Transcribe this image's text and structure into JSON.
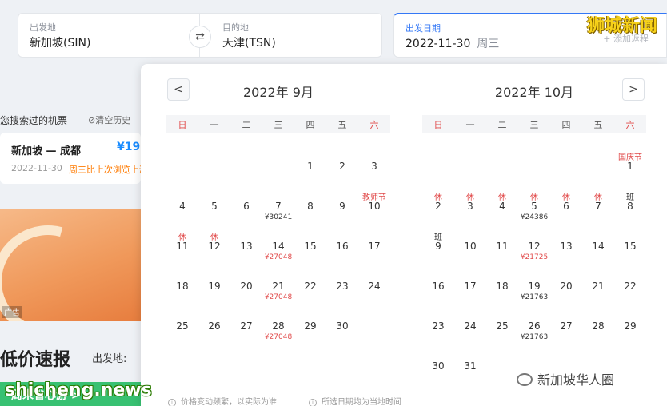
{
  "search": {
    "from_label": "出发地",
    "from_value": "新加坡(SIN)",
    "to_label": "目的地",
    "to_value": "天津(TSN)",
    "date_label": "出发日期",
    "date_value": "2022-11-30",
    "date_weekday": "周三",
    "add_return": "+ 添加返程",
    "swap_icon": "swap-icon"
  },
  "watermarks": {
    "top": "狮城新闻",
    "bottom": "shicheng.news"
  },
  "history": {
    "title": "您搜索过的机票",
    "clear": "⊘清空历史",
    "item": {
      "route": "新加坡 — 成都",
      "price": "¥19",
      "date": "2022-11-30",
      "note": "周三比上次浏览上涨"
    }
  },
  "ad_tag": "广告",
  "lowprice": {
    "title": "低价速报",
    "from_label": "出发地:"
  },
  "green_banner": "周末省心游 >",
  "calendar": {
    "prev_icon": "chevron-left-icon",
    "next_icon": "chevron-right-icon",
    "weekdays": [
      "日",
      "一",
      "二",
      "三",
      "四",
      "五",
      "六"
    ],
    "months": [
      {
        "title": "2022年 9月",
        "first_weekday": 4,
        "days": [
          {
            "d": "1"
          },
          {
            "d": "2"
          },
          {
            "d": "3"
          },
          {
            "d": "4"
          },
          {
            "d": "5"
          },
          {
            "d": "6"
          },
          {
            "d": "7",
            "price": "¥30241"
          },
          {
            "d": "8"
          },
          {
            "d": "9"
          },
          {
            "d": "10",
            "tag": "教师节"
          },
          {
            "d": "11",
            "tag": "休"
          },
          {
            "d": "12",
            "tag": "休"
          },
          {
            "d": "13"
          },
          {
            "d": "14",
            "price": "¥27048",
            "red": true
          },
          {
            "d": "15"
          },
          {
            "d": "16"
          },
          {
            "d": "17"
          },
          {
            "d": "18"
          },
          {
            "d": "19"
          },
          {
            "d": "20"
          },
          {
            "d": "21",
            "price": "¥27048",
            "red": true
          },
          {
            "d": "22"
          },
          {
            "d": "23"
          },
          {
            "d": "24"
          },
          {
            "d": "25"
          },
          {
            "d": "26"
          },
          {
            "d": "27"
          },
          {
            "d": "28",
            "price": "¥27048",
            "red": true
          },
          {
            "d": "29"
          },
          {
            "d": "30"
          }
        ]
      },
      {
        "title": "2022年 10月",
        "first_weekday": 6,
        "days": [
          {
            "d": "1",
            "tag": "国庆节"
          },
          {
            "d": "2",
            "tag": "休"
          },
          {
            "d": "3",
            "tag": "休"
          },
          {
            "d": "4",
            "tag": "休"
          },
          {
            "d": "5",
            "tag": "休",
            "price": "¥24386"
          },
          {
            "d": "6",
            "tag": "休"
          },
          {
            "d": "7",
            "tag": "休"
          },
          {
            "d": "8",
            "tag": "班",
            "work": true
          },
          {
            "d": "9",
            "tag": "班",
            "work": true
          },
          {
            "d": "10"
          },
          {
            "d": "11"
          },
          {
            "d": "12",
            "price": "¥21725",
            "red": true
          },
          {
            "d": "13"
          },
          {
            "d": "14"
          },
          {
            "d": "15"
          },
          {
            "d": "16"
          },
          {
            "d": "17"
          },
          {
            "d": "18"
          },
          {
            "d": "19",
            "price": "¥21763"
          },
          {
            "d": "20"
          },
          {
            "d": "21"
          },
          {
            "d": "22"
          },
          {
            "d": "23"
          },
          {
            "d": "24"
          },
          {
            "d": "25"
          },
          {
            "d": "26",
            "price": "¥21763"
          },
          {
            "d": "27"
          },
          {
            "d": "28"
          },
          {
            "d": "29"
          },
          {
            "d": "30"
          },
          {
            "d": "31"
          }
        ]
      }
    ],
    "footnotes": [
      "价格变动频繁，以实际为准",
      "所选日期均为当地时间"
    ]
  },
  "wechat": {
    "label": "新加坡华人圈",
    "icon": "wechat-icon"
  },
  "colors": {
    "accent": "#3478f6",
    "holiday": "#e14a4a",
    "price_blue": "#1a8cff",
    "banner_green": "#38c172"
  }
}
